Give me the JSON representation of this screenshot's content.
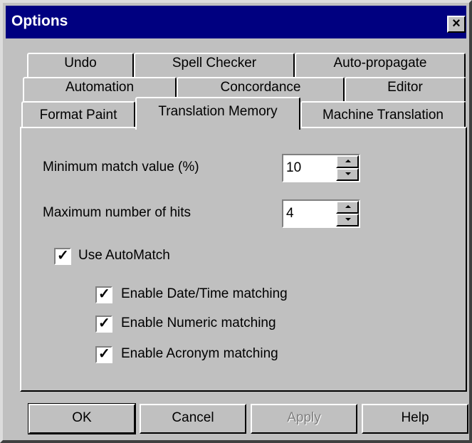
{
  "window": {
    "title": "Options",
    "close_icon": "×"
  },
  "tabs": {
    "row1": [
      "Undo",
      "Spell Checker",
      "Auto-propagate"
    ],
    "row2": [
      "Automation",
      "Concordance",
      "Editor"
    ],
    "row3": [
      "Format Paint",
      "Translation Memory",
      "Machine Translation"
    ],
    "active": "Translation Memory"
  },
  "fields": {
    "min_match": {
      "label": "Minimum match value (%)",
      "value": "10"
    },
    "max_hits": {
      "label": "Maximum number of hits",
      "value": "4"
    }
  },
  "checkboxes": {
    "use_automatch": {
      "label": "Use AutoMatch",
      "checked": true
    },
    "date_time": {
      "label": "Enable Date/Time matching",
      "checked": true
    },
    "numeric": {
      "label": "Enable Numeric matching",
      "checked": true
    },
    "acronym": {
      "label": "Enable Acronym matching",
      "checked": true
    }
  },
  "buttons": {
    "ok": "OK",
    "cancel": "Cancel",
    "apply": "Apply",
    "help": "Help"
  },
  "colors": {
    "titlebar": "#000080",
    "face": "#c0c0c0"
  }
}
